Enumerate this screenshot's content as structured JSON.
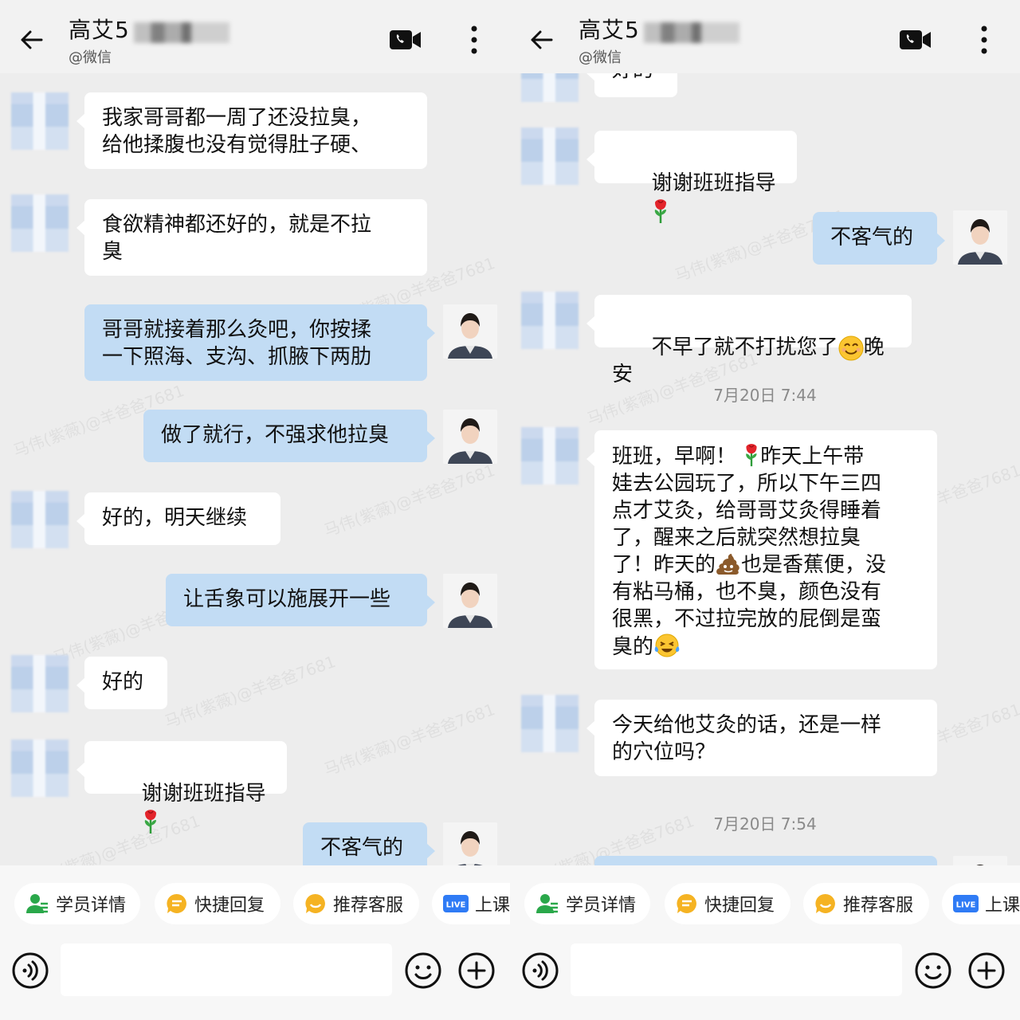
{
  "colors": {
    "incoming_bubble": "#ffffff",
    "outgoing_bubble": "#c2dcf4",
    "background": "#ededed"
  },
  "left": {
    "header": {
      "title": "高艾5",
      "subtitle": "@微信"
    },
    "messages": [
      {
        "text": "我家哥哥都一周了还没拉臭，\n给他揉腹也没有觉得肚子硬、"
      },
      {
        "text": "食欲精神都还好的，就是不拉\n臭"
      },
      {
        "text": "哥哥就接着那么灸吧，你按揉\n一下照海、支沟、抓腋下两肋"
      },
      {
        "text": "做了就行，不强求他拉臭"
      },
      {
        "text": "好的，明天继续"
      },
      {
        "text": "让舌象可以施展开一些"
      },
      {
        "text": "好的"
      },
      {
        "text": "谢谢班班指导"
      },
      {
        "text": "不客气的"
      }
    ]
  },
  "right": {
    "header": {
      "title": "高艾5",
      "subtitle": "@微信"
    },
    "messages": [
      {
        "text": "好的"
      },
      {
        "text": "谢谢班班指导"
      },
      {
        "text": "不客气的"
      },
      {
        "text": "不早了就不打扰您了",
        "suffix": "晚安"
      },
      {
        "text": "班班，早啊！",
        "line1_rest": "昨天上午带",
        "rest": "娃去公园玩了，所以下午三四\n点才艾灸，给哥哥艾灸得睡着\n了，醒来之后就突然想拉臭\n了！昨天的",
        "rest2": "也是香蕉便，没\n有粘马桶，也不臭，颜色没有\n很黑，不过拉完放的屁倒是蛮\n臭的"
      },
      {
        "text": "今天给他艾灸的话，还是一样\n的穴位吗？"
      }
    ],
    "timestamps": [
      "7月20日  7:44",
      "7月20日  7:54"
    ]
  },
  "quick_actions": [
    "学员详情",
    "快捷回复",
    "推荐客服",
    "上课"
  ],
  "live_badge": "LIVE",
  "watermark": "马伟(紫薇)@羊爸爸7681",
  "icons": [
    "back-arrow-icon",
    "video-call-icon",
    "more-icon",
    "rose-icon",
    "smile-emoji-icon",
    "poop-emoji-icon",
    "laugh-cry-emoji-icon",
    "voice-icon",
    "emoji-icon",
    "plus-icon"
  ]
}
